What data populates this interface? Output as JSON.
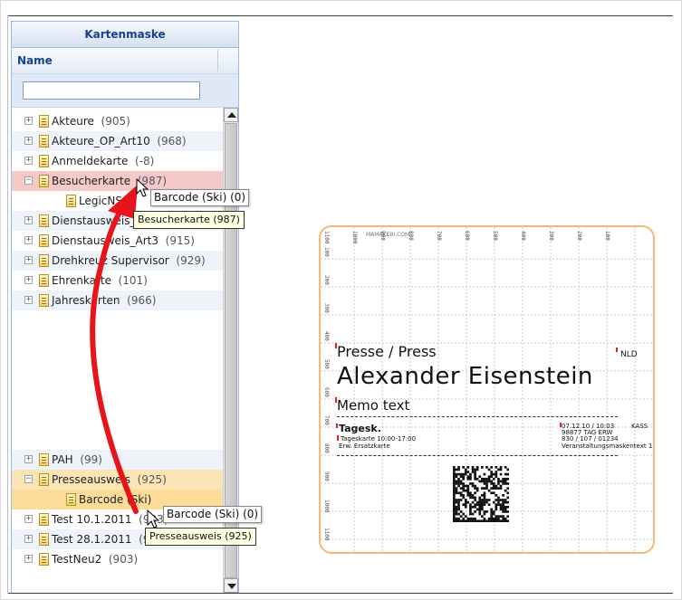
{
  "panel": {
    "title": "Kartenmaske",
    "column_header": "Name",
    "filter_value": ""
  },
  "tree": {
    "nodes": [
      {
        "label": "Akteure",
        "count": "(905)",
        "expander": "+"
      },
      {
        "label": "Akteure_OP_Art10",
        "count": "(968)",
        "expander": "+"
      },
      {
        "label": "Anmeldekarte",
        "count": "(-8)",
        "expander": "+"
      },
      {
        "label": "Besucherkarte",
        "count": "(987)",
        "expander": "−"
      },
      {
        "label": "LegicNSO",
        "count": "",
        "expander": ""
      },
      {
        "label": "Dienstausweis_Art1-2",
        "count": "(959)",
        "expander": "+"
      },
      {
        "label": "Dienstausweis_Art3",
        "count": "(915)",
        "expander": "+"
      },
      {
        "label": "Drehkreuz Supervisor",
        "count": "(929)",
        "expander": "+"
      },
      {
        "label": "Ehrenkarte",
        "count": "(101)",
        "expander": "+"
      },
      {
        "label": "Jahreskarten",
        "count": "(966)",
        "expander": "+"
      },
      {
        "label": "PAH",
        "count": "(99)",
        "expander": "+"
      },
      {
        "label": "Presseausweis",
        "count": "(925)",
        "expander": "−"
      },
      {
        "label": "Barcode (Ski)",
        "count": "",
        "expander": ""
      },
      {
        "label": "Test 10.1.2011",
        "count": "(933)",
        "expander": "+"
      },
      {
        "label": "Test 28.1.2011",
        "count": "(931)",
        "expander": "+"
      },
      {
        "label": "TestNeu2",
        "count": "(903)",
        "expander": "+"
      }
    ]
  },
  "drag": {
    "ghost_top": "Barcode (Ski)  (0)",
    "tooltip_top": "Besucherkarte (987)",
    "ghost_bottom": "Barcode (Ski)  (0)",
    "tooltip_bottom": "Presseausweis (925)",
    "arrow_color": "#e8141c"
  },
  "card": {
    "watermark": "MAMAKEBI.COM",
    "role": "Presse / Press",
    "name": "Alexander  Eisenstein",
    "memo": "Memo text",
    "country": "NLD",
    "ticket_title": "Tagesk.",
    "ticket_line1": "Tageskarte 10:00-17:00",
    "ticket_line2": "Erw. Ersatzkarte",
    "info_line1": "07.12.10 / 10:03",
    "info_line2": "98877   TAG ERW",
    "info_line3": "830 / 107 / 01234",
    "info_line4": "Veranstaltungsmaskentext 1",
    "info_side": "KASS",
    "ruler_top": [
      "1100",
      "1000",
      "900",
      "800",
      "700",
      "600",
      "500",
      "400",
      "300",
      "200",
      "100"
    ],
    "ruler_left": [
      "100",
      "200",
      "300",
      "400",
      "500",
      "600",
      "700",
      "800",
      "900",
      "1000",
      "1100"
    ],
    "border_color": "#f4b97a"
  }
}
